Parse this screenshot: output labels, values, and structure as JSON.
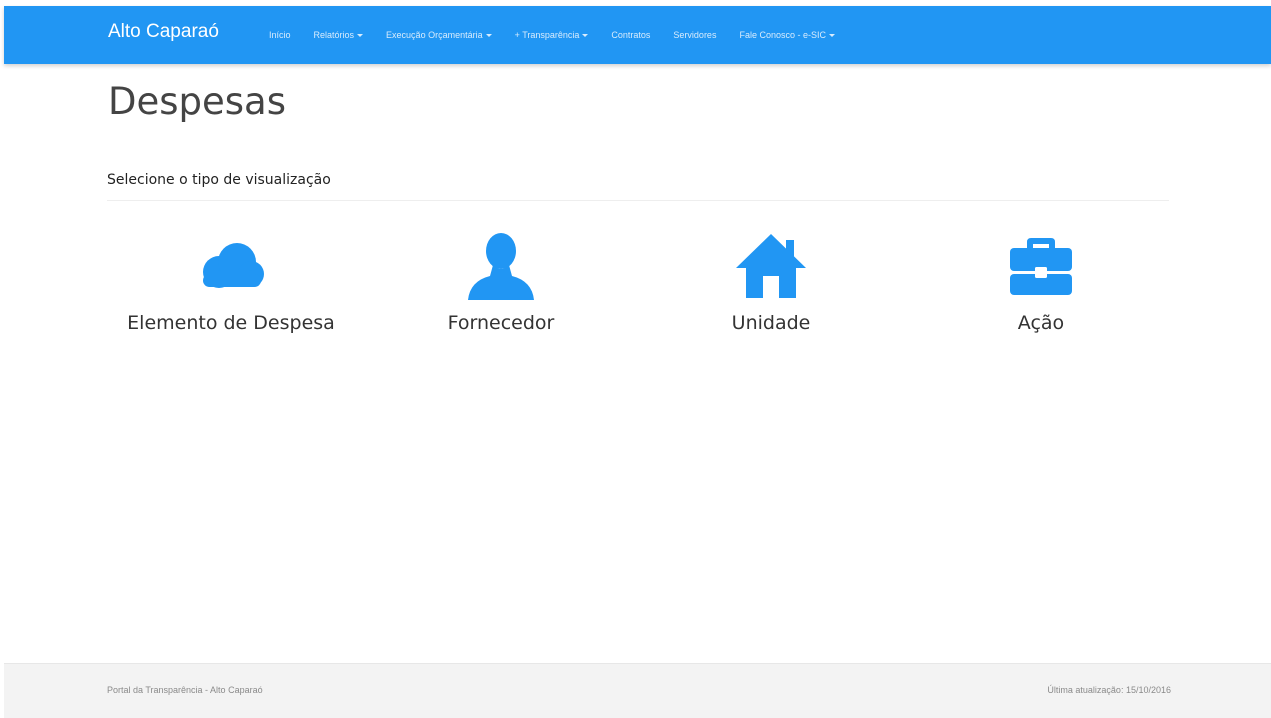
{
  "navbar": {
    "brand": "Alto Caparaó",
    "background_color": "#2196f3",
    "items": [
      {
        "label": "Início",
        "has_dropdown": false
      },
      {
        "label": "Relatórios",
        "has_dropdown": true
      },
      {
        "label": "Execução Orçamentária",
        "has_dropdown": true
      },
      {
        "label": "+ Transparência",
        "has_dropdown": true
      },
      {
        "label": "Contratos",
        "has_dropdown": false
      },
      {
        "label": "Servidores",
        "has_dropdown": false
      },
      {
        "label": "Fale Conosco - e-SIC",
        "has_dropdown": true
      }
    ]
  },
  "page": {
    "title": "Despesas",
    "subtitle": "Selecione o tipo de visualização"
  },
  "options": {
    "icon_color": "#2196f3",
    "items": [
      {
        "label": "Elemento de Despesa",
        "icon": "cloud-icon"
      },
      {
        "label": "Fornecedor",
        "icon": "user-icon"
      },
      {
        "label": "Unidade",
        "icon": "home-icon"
      },
      {
        "label": "Ação",
        "icon": "briefcase-icon"
      }
    ]
  },
  "footer": {
    "left_text": "Portal da Transparência - Alto Caparaó",
    "right_text": "Última atualização: 15/10/2016"
  }
}
